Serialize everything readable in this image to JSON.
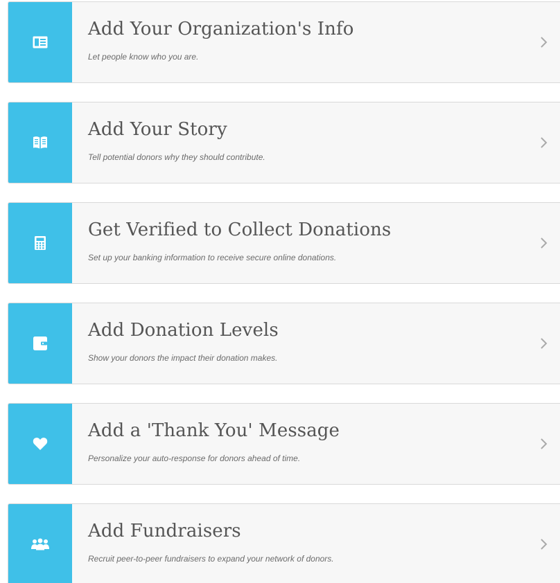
{
  "colors": {
    "accent": "#3fc0e8",
    "card_background": "#f7f7f7",
    "title_text": "#555555",
    "subtitle_text": "#6b6b6b",
    "chevron": "#aaaaaa"
  },
  "items": [
    {
      "title": "Add Your Organization's Info",
      "subtitle": "Let people know who you are.",
      "icon": "id-card-icon"
    },
    {
      "title": "Add Your Story",
      "subtitle": "Tell potential donors why they should contribute.",
      "icon": "open-book-icon"
    },
    {
      "title": "Get Verified to Collect Donations",
      "subtitle": "Set up your banking information to receive secure online donations.",
      "icon": "calculator-icon"
    },
    {
      "title": "Add Donation Levels",
      "subtitle": "Show your donors the impact their donation makes.",
      "icon": "wallet-icon"
    },
    {
      "title": "Add a 'Thank You' Message",
      "subtitle": "Personalize your auto-response for donors ahead of time.",
      "icon": "heart-icon"
    },
    {
      "title": "Add Fundraisers",
      "subtitle": "Recruit peer-to-peer fundraisers to expand your network of donors.",
      "icon": "group-icon"
    }
  ]
}
